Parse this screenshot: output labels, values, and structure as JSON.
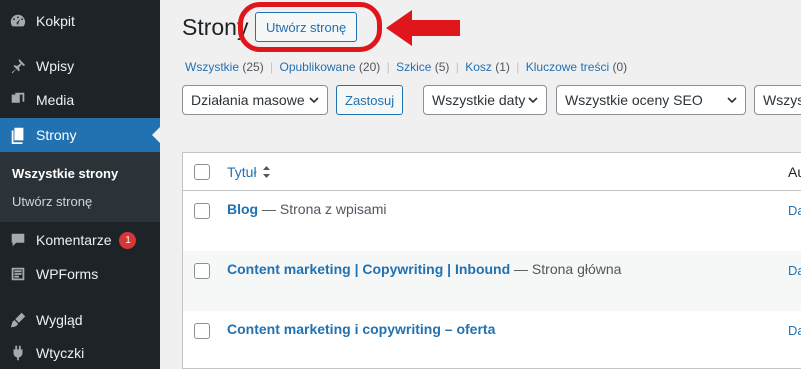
{
  "sidebar": {
    "items": [
      {
        "label": "Kokpit",
        "icon": "dashboard-icon"
      },
      {
        "label": "Wpisy",
        "icon": "pin-icon"
      },
      {
        "label": "Media",
        "icon": "media-icon"
      },
      {
        "label": "Strony",
        "icon": "pages-icon",
        "active": true
      },
      {
        "label": "Komentarze",
        "icon": "comment-icon",
        "badge": "1"
      },
      {
        "label": "WPForms",
        "icon": "forms-icon"
      },
      {
        "label": "Wygląd",
        "icon": "brush-icon"
      },
      {
        "label": "Wtyczki",
        "icon": "plugin-icon"
      }
    ],
    "submenu": [
      "Wszystkie strony",
      "Utwórz stronę"
    ]
  },
  "header": {
    "title": "Strony",
    "add_new": "Utwórz stronę"
  },
  "filters": {
    "views": [
      {
        "label": "Wszystkie",
        "count": "(25)"
      },
      {
        "label": "Opublikowane",
        "count": "(20)"
      },
      {
        "label": "Szkice",
        "count": "(5)"
      },
      {
        "label": "Kosz",
        "count": "(1)"
      },
      {
        "label": "Kluczowe treści",
        "count": "(0)"
      }
    ],
    "bulk_action": "Działania masowe",
    "apply": "Zastosuj",
    "dates": "Wszystkie daty",
    "seo": "Wszystkie oceny SEO",
    "more": "Wszys"
  },
  "table": {
    "col_title": "Tytuł",
    "col_author": "Au",
    "rows": [
      {
        "title": "Blog",
        "state": " — Strona z wpisami",
        "author": "Da"
      },
      {
        "title": "Content marketing | Copywriting | Inbound",
        "state": " — Strona główna",
        "author": "Da"
      },
      {
        "title": "Content marketing i copywriting – oferta",
        "state": "",
        "author": "Da"
      }
    ]
  },
  "colors": {
    "sidebar_bg": "#1d2327",
    "accent": "#2271b1",
    "highlight": "#e0161d"
  }
}
